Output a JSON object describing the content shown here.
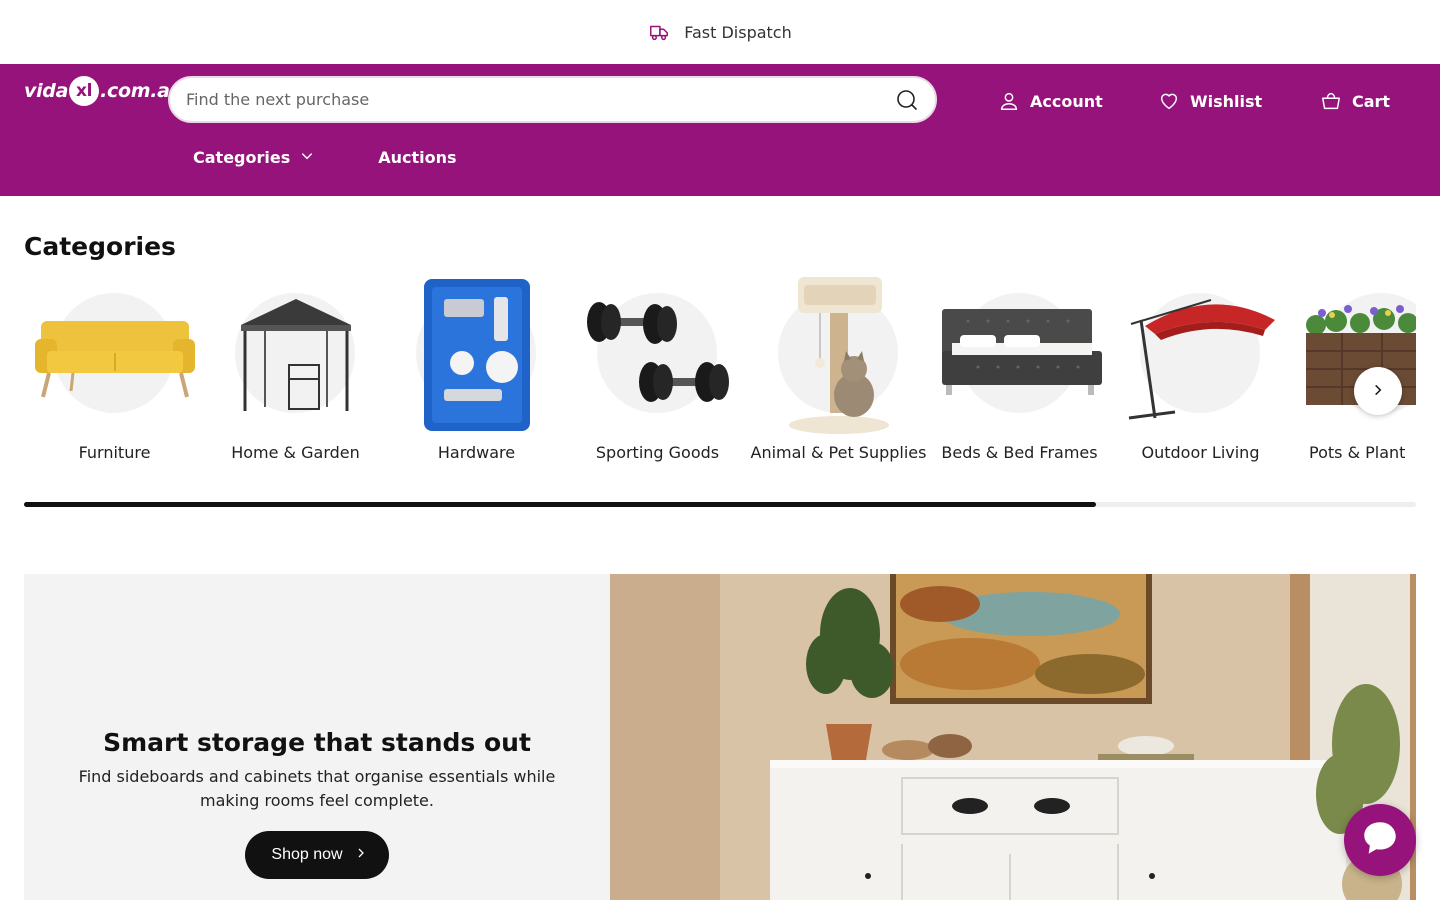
{
  "announcement": {
    "text": "Fast Dispatch",
    "icon": "delivery-truck-icon"
  },
  "brand": {
    "name_prefix": "vida",
    "name_mark": "xl",
    "name_suffix": ".com.au",
    "color": "#95137a"
  },
  "search": {
    "placeholder": "Find the next purchase",
    "value": ""
  },
  "header_nav": {
    "account": "Account",
    "wishlist": "Wishlist",
    "cart": "Cart"
  },
  "sub_nav": {
    "categories": "Categories",
    "auctions": "Auctions"
  },
  "categories_section": {
    "title": "Categories",
    "items": [
      {
        "label": "Furniture",
        "icon": "sofa-image"
      },
      {
        "label": "Home & Garden",
        "icon": "gazebo-image"
      },
      {
        "label": "Hardware",
        "icon": "spray-gun-kit-image"
      },
      {
        "label": "Sporting Goods",
        "icon": "dumbbells-image"
      },
      {
        "label": "Animal & Pet Supplies",
        "icon": "cat-tree-image"
      },
      {
        "label": "Beds & Bed Frames",
        "icon": "bed-image"
      },
      {
        "label": "Outdoor Living",
        "icon": "umbrella-image"
      },
      {
        "label": "Pots & Plant",
        "icon": "planter-image"
      }
    ],
    "scroll_progress": 0.77
  },
  "promo": {
    "title": "Smart storage that stands out",
    "text": "Find sideboards and cabinets that organise essentials while making rooms feel complete.",
    "button": "Shop now"
  },
  "chat": {
    "icon": "chat-bubble-icon"
  }
}
